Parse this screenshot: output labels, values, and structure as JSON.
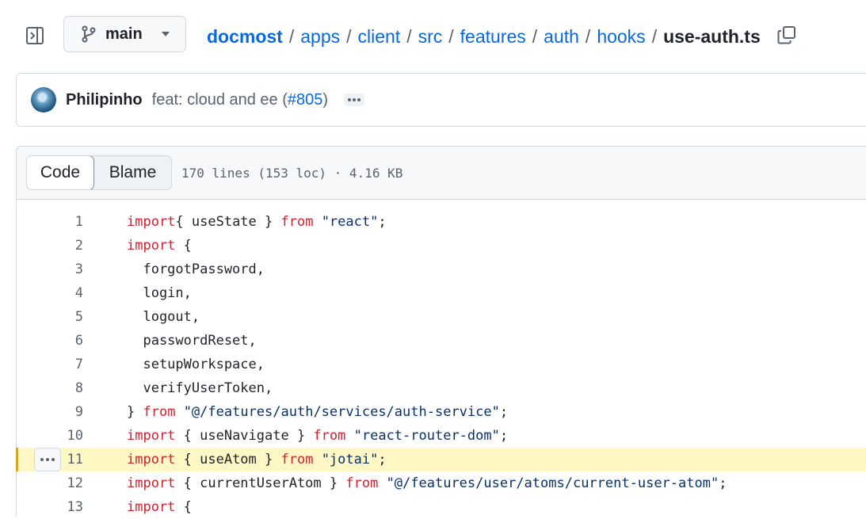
{
  "toolbar": {
    "panel_toggle_icon": "sidebar-expand-icon",
    "branch": {
      "label": "main",
      "icon": "git-branch-icon",
      "caret_icon": "triangle-down-icon"
    },
    "copy_icon": "copy-icon"
  },
  "breadcrumb": {
    "repo": "docmost",
    "parts": [
      "apps",
      "client",
      "src",
      "features",
      "auth",
      "hooks"
    ],
    "separator": "/",
    "current": "use-auth.ts"
  },
  "commit": {
    "author": "Philipinho",
    "message": "feat: cloud and ee (",
    "pr": "#805",
    "message_end": ")",
    "more_icon": "kebab-horizontal-icon"
  },
  "file_header": {
    "tabs": [
      "Code",
      "Blame"
    ],
    "active_tab": "Code",
    "meta": "170 lines (153 loc) · 4.16 KB"
  },
  "code": {
    "highlighted_line": 11,
    "lines": [
      {
        "num": "1",
        "tokens": [
          [
            "kw",
            "import"
          ],
          [
            "",
            "{ useState } "
          ],
          [
            "kw",
            "from"
          ],
          [
            "",
            " "
          ],
          [
            "str",
            "\"react\""
          ],
          [
            "",
            ";"
          ]
        ]
      },
      {
        "num": "2",
        "tokens": [
          [
            "kw",
            "import"
          ],
          [
            "",
            " {"
          ]
        ]
      },
      {
        "num": "3",
        "tokens": [
          [
            "",
            "  forgotPassword,"
          ]
        ]
      },
      {
        "num": "4",
        "tokens": [
          [
            "",
            "  login,"
          ]
        ]
      },
      {
        "num": "5",
        "tokens": [
          [
            "",
            "  logout,"
          ]
        ]
      },
      {
        "num": "6",
        "tokens": [
          [
            "",
            "  passwordReset,"
          ]
        ]
      },
      {
        "num": "7",
        "tokens": [
          [
            "",
            "  setupWorkspace,"
          ]
        ]
      },
      {
        "num": "8",
        "tokens": [
          [
            "",
            "  verifyUserToken,"
          ]
        ]
      },
      {
        "num": "9",
        "tokens": [
          [
            "",
            "} "
          ],
          [
            "kw",
            "from"
          ],
          [
            "",
            " "
          ],
          [
            "str",
            "\"@/features/auth/services/auth-service\""
          ],
          [
            "",
            ";"
          ]
        ]
      },
      {
        "num": "10",
        "tokens": [
          [
            "kw",
            "import"
          ],
          [
            "",
            " { useNavigate } "
          ],
          [
            "kw",
            "from"
          ],
          [
            "",
            " "
          ],
          [
            "str",
            "\"react-router-dom\""
          ],
          [
            "",
            ";"
          ]
        ]
      },
      {
        "num": "11",
        "tokens": [
          [
            "kw",
            "import"
          ],
          [
            "",
            " { useAtom } "
          ],
          [
            "kw",
            "from"
          ],
          [
            "",
            " "
          ],
          [
            "str",
            "\"jotai\""
          ],
          [
            "",
            ";"
          ]
        ]
      },
      {
        "num": "12",
        "tokens": [
          [
            "kw",
            "import"
          ],
          [
            "",
            " { currentUserAtom } "
          ],
          [
            "kw",
            "from"
          ],
          [
            "",
            " "
          ],
          [
            "str",
            "\"@/features/user/atoms/current-user-atom\""
          ],
          [
            "",
            ";"
          ]
        ]
      },
      {
        "num": "13",
        "tokens": [
          [
            "kw",
            "import"
          ],
          [
            "",
            " {"
          ]
        ]
      }
    ]
  },
  "colors": {
    "link": "#0969da",
    "keyword": "#cf222e",
    "string": "#0a3069",
    "highlight_bg": "#fff8c5",
    "highlight_bar": "#d4a72c"
  }
}
